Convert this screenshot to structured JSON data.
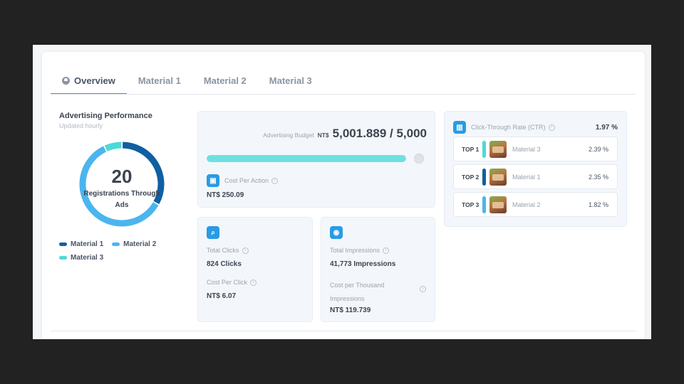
{
  "tabs": [
    {
      "label": "Overview",
      "icon": "chat-bubble-icon",
      "active": true
    },
    {
      "label": "Material 1",
      "active": false
    },
    {
      "label": "Material 2",
      "active": false
    },
    {
      "label": "Material 3",
      "active": false
    }
  ],
  "performance": {
    "title": "Advertising Performance",
    "subtitle": "Updated hourly",
    "total": "20",
    "total_label": "Registrations Through Ads",
    "segments": [
      {
        "name": "Material 1",
        "fraction": 0.33,
        "color": "#0f5fa3"
      },
      {
        "name": "Material 2",
        "fraction": 0.6,
        "color": "#4bb5ef"
      },
      {
        "name": "Material 3",
        "fraction": 0.07,
        "color": "#4dd9d9"
      }
    ],
    "legend": [
      {
        "label": "Material 1",
        "color": "#0f5fa3"
      },
      {
        "label": "Material 2",
        "color": "#4bb5ef"
      },
      {
        "label": "Material 3",
        "color": "#4dd9d9"
      }
    ]
  },
  "budget": {
    "label": "Advertising Budget",
    "currency": "NT$",
    "value": "5,001.889 / 5,000",
    "progress": 1.0
  },
  "cpa": {
    "label": "Cost Per Action",
    "value": "NT$ 250.09",
    "icon": "ticket-icon"
  },
  "clicks": {
    "icon": "click-icon",
    "label": "Total Clicks",
    "value": "824 Clicks",
    "cpc_label": "Cost Per Click",
    "cpc_value": "NT$ 6.07"
  },
  "impressions": {
    "icon": "eye-icon",
    "label": "Total Impressions",
    "value": "41,773 Impressions",
    "cpm_label": "Cost per Thousand Impressions",
    "cpm_value": "NT$ 119.739"
  },
  "ctr": {
    "icon": "bar-chart-icon",
    "title": "Click-Through Rate (CTR)",
    "total": "1.97 %",
    "ranks": [
      {
        "rank": "TOP 1",
        "name": "Material 3",
        "value": "2.39 %",
        "color": "#4dd9d9"
      },
      {
        "rank": "TOP 2",
        "name": "Material 1",
        "value": "2.35 %",
        "color": "#0f5fa3"
      },
      {
        "rank": "TOP 3",
        "name": "Material 2",
        "value": "1.82 %",
        "color": "#4bb5ef"
      }
    ]
  }
}
